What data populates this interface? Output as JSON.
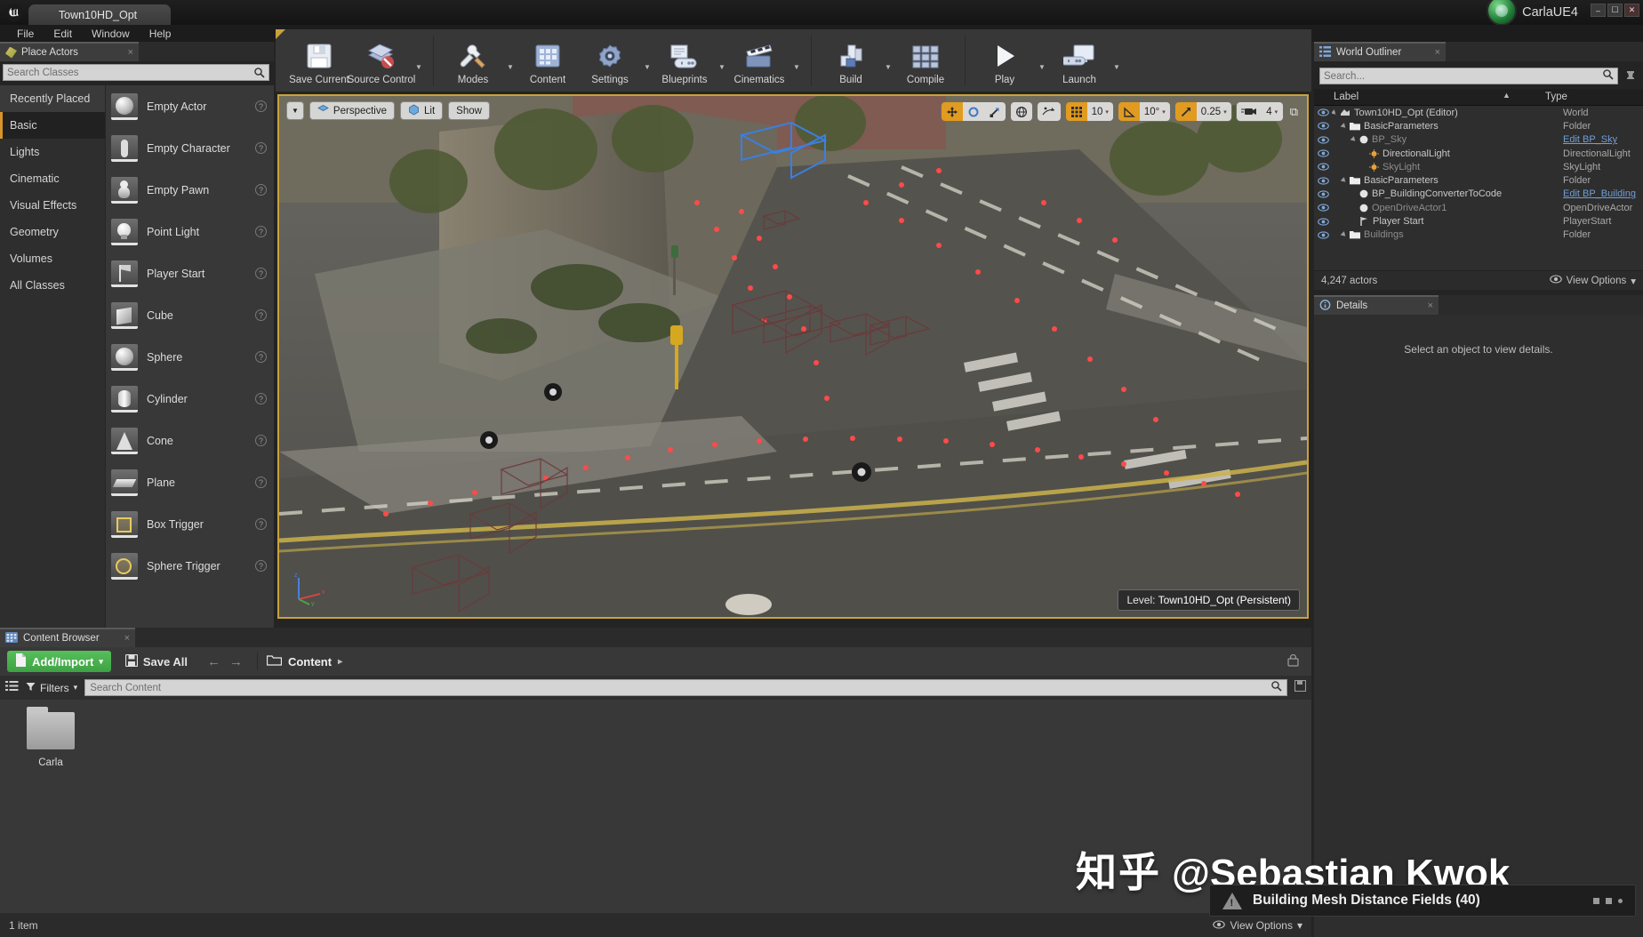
{
  "titlebar": {
    "project_tab": "Town10HD_Opt",
    "brand": "CarlaUE4",
    "logo_glyph": "U",
    "min": "–",
    "max": "☐",
    "close": "✕"
  },
  "menu": {
    "items": [
      "File",
      "Edit",
      "Window",
      "Help"
    ]
  },
  "place_actors": {
    "tab_label": "Place Actors",
    "close_glyph": "×",
    "search_placeholder": "Search Classes",
    "categories": [
      {
        "label": "Recently Placed",
        "selected": false,
        "top": true
      },
      {
        "label": "Basic",
        "selected": true,
        "top": false
      },
      {
        "label": "Lights",
        "selected": false,
        "top": false
      },
      {
        "label": "Cinematic",
        "selected": false,
        "top": false
      },
      {
        "label": "Visual Effects",
        "selected": false,
        "top": false
      },
      {
        "label": "Geometry",
        "selected": false,
        "top": false
      },
      {
        "label": "Volumes",
        "selected": false,
        "top": false
      },
      {
        "label": "All Classes",
        "selected": false,
        "top": false
      }
    ],
    "actors": [
      {
        "label": "Empty Actor",
        "shape": "sphere"
      },
      {
        "label": "Empty Character",
        "shape": "person"
      },
      {
        "label": "Empty Pawn",
        "shape": "pawn"
      },
      {
        "label": "Point Light",
        "shape": "bulb"
      },
      {
        "label": "Player Start",
        "shape": "flag"
      },
      {
        "label": "Cube",
        "shape": "cube"
      },
      {
        "label": "Sphere",
        "shape": "sphere"
      },
      {
        "label": "Cylinder",
        "shape": "cyl"
      },
      {
        "label": "Cone",
        "shape": "cone"
      },
      {
        "label": "Plane",
        "shape": "plane"
      },
      {
        "label": "Box Trigger",
        "shape": "boxt"
      },
      {
        "label": "Sphere Trigger",
        "shape": "spht"
      }
    ],
    "help_glyph": "?"
  },
  "toolbar": {
    "groups": [
      {
        "items": [
          {
            "label": "Save Current",
            "icon": "save-icon",
            "arrow": false
          },
          {
            "label": "Source Control",
            "icon": "source-control-icon",
            "arrow": true
          }
        ]
      },
      {
        "items": [
          {
            "label": "Modes",
            "icon": "modes-icon",
            "arrow": true
          },
          {
            "label": "Content",
            "icon": "content-icon",
            "arrow": false
          },
          {
            "label": "Settings",
            "icon": "settings-icon",
            "arrow": true
          },
          {
            "label": "Blueprints",
            "icon": "blueprints-icon",
            "arrow": true
          },
          {
            "label": "Cinematics",
            "icon": "cinematics-icon",
            "arrow": true
          }
        ]
      },
      {
        "items": [
          {
            "label": "Build",
            "icon": "build-icon",
            "arrow": true
          },
          {
            "label": "Compile",
            "icon": "compile-icon",
            "arrow": false
          }
        ]
      },
      {
        "items": [
          {
            "label": "Play",
            "icon": "play-icon",
            "arrow": true
          },
          {
            "label": "Launch",
            "icon": "launch-icon",
            "arrow": true
          }
        ]
      }
    ],
    "arrow_glyph": "▼"
  },
  "viewport": {
    "menu_arrow": "▼",
    "perspective_label": "Perspective",
    "lit_label": "Lit",
    "show_label": "Show",
    "transform_tools": [
      {
        "name": "translate-tool",
        "active": true
      },
      {
        "name": "rotate-tool",
        "active": false
      },
      {
        "name": "scale-tool",
        "active": false
      }
    ],
    "coord_space": "world-icon",
    "surface_snap": "surface-snap-icon",
    "grid_snap_active": true,
    "grid_size": "10",
    "angle_snap_active": true,
    "angle_size": "10°",
    "scale_snap_active": true,
    "scale_size": "0.25",
    "camera_speed": "4",
    "maximize_glyph": "⧉",
    "level_prefix": "Level:",
    "level_name": "Town10HD_Opt (Persistent)"
  },
  "world_outliner": {
    "tab_label": "World Outliner",
    "close_glyph": "×",
    "search_placeholder": "Search...",
    "col_label": "Label",
    "col_type": "Type",
    "sort_glyph": "▲",
    "rows": [
      {
        "label": "Town10HD_Opt (Editor)",
        "type": "World",
        "indent": 0,
        "icon": "world-icon",
        "caret": true,
        "dim": false,
        "link": false
      },
      {
        "label": "BasicParameters",
        "type": "Folder",
        "indent": 1,
        "icon": "folder-icon",
        "caret": true,
        "dim": false,
        "link": false
      },
      {
        "label": "BP_Sky",
        "type": "Edit BP_Sky",
        "indent": 2,
        "icon": "actor-icon",
        "caret": true,
        "dim": true,
        "link": true
      },
      {
        "label": "DirectionalLight",
        "type": "DirectionalLight",
        "indent": 3,
        "icon": "light-icon",
        "caret": false,
        "dim": false,
        "link": false
      },
      {
        "label": "SkyLight",
        "type": "SkyLight",
        "indent": 3,
        "icon": "light-icon",
        "caret": false,
        "dim": true,
        "link": false
      },
      {
        "label": "BasicParameters",
        "type": "Folder",
        "indent": 1,
        "icon": "folder-icon",
        "caret": true,
        "dim": false,
        "link": false
      },
      {
        "label": "BP_BuildingConverterToCode",
        "type": "Edit BP_Building",
        "indent": 2,
        "icon": "actor-icon",
        "caret": false,
        "dim": false,
        "link": true
      },
      {
        "label": "OpenDriveActor1",
        "type": "OpenDriveActor",
        "indent": 2,
        "icon": "actor-icon",
        "caret": false,
        "dim": true,
        "link": false
      },
      {
        "label": "Player Start",
        "type": "PlayerStart",
        "indent": 2,
        "icon": "playerstart-icon",
        "caret": false,
        "dim": false,
        "link": false
      },
      {
        "label": "Buildings",
        "type": "Folder",
        "indent": 1,
        "icon": "folder-icon",
        "caret": true,
        "dim": true,
        "link": false
      }
    ],
    "actor_count": "4,247 actors",
    "view_options": "View Options",
    "view_options_arrow": "▾"
  },
  "details": {
    "tab_label": "Details",
    "close_glyph": "×",
    "empty_message": "Select an object to view details."
  },
  "content_browser": {
    "tab_label": "Content Browser",
    "close_glyph": "×",
    "add_import_label": "Add/Import",
    "add_import_arrow": "▾",
    "save_all_label": "Save All",
    "back_glyph": "←",
    "forward_glyph": "→",
    "breadcrumb": "Content",
    "breadcrumb_arrow": "▸",
    "lock_glyph": "⎙",
    "filters_label": "Filters",
    "filters_arrow": "▾",
    "search_placeholder": "Search Content",
    "assets": [
      {
        "name": "Carla",
        "type": "folder"
      }
    ],
    "status": "1 item",
    "view_options": "View Options",
    "view_options_arrow": "▾"
  },
  "watermark": {
    "logo": "知乎",
    "handle": "@Sebastian Kwok"
  },
  "toast": {
    "message": "Building Mesh Distance Fields (40)",
    "icon": "warning-icon",
    "dots": [
      7,
      7,
      5
    ]
  },
  "colors": {
    "accent_orange": "#e09b20",
    "viewport_border": "#c9a23b",
    "add_green": "#3da243",
    "link_blue": "#6f9fd8"
  }
}
